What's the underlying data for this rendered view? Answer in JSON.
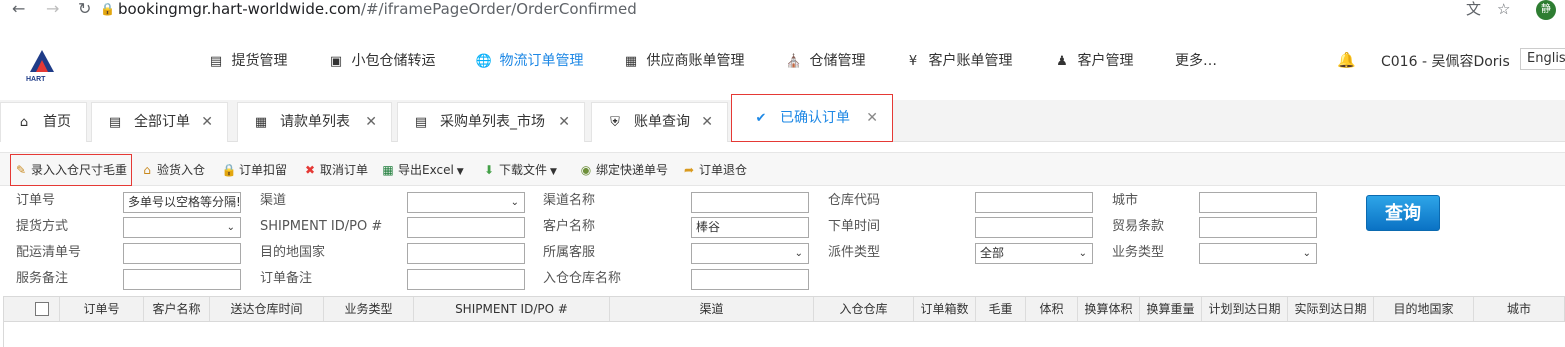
{
  "browser": {
    "url_host": "bookingmgr.hart-worldwide.com",
    "url_path": "/#/iframePageOrder/OrderConfirmed",
    "avatar_text": "静"
  },
  "topnav": {
    "logo_text": "HART",
    "items": [
      {
        "label": "提货管理",
        "icon": "truck-icon"
      },
      {
        "label": "小包仓储转运",
        "icon": "box-icon"
      },
      {
        "label": "物流订单管理",
        "icon": "globe-icon",
        "active": true
      },
      {
        "label": "供应商账单管理",
        "icon": "calendar-icon"
      },
      {
        "label": "仓储管理",
        "icon": "warehouse-icon"
      },
      {
        "label": "客户账单管理",
        "icon": "yen-icon"
      },
      {
        "label": "客户管理",
        "icon": "people-icon"
      },
      {
        "label": "更多…",
        "icon": ""
      }
    ],
    "user": "C016 - 吴佩容Doris",
    "lang": "English"
  },
  "tabs": [
    {
      "label": "首页",
      "icon": "home-icon",
      "closable": false
    },
    {
      "label": "全部订单",
      "icon": "list-icon",
      "closable": true
    },
    {
      "label": "请款单列表",
      "icon": "calendar-icon",
      "closable": true
    },
    {
      "label": "采购单列表_市场",
      "icon": "list-icon",
      "closable": true
    },
    {
      "label": "账单查询",
      "icon": "shield-icon",
      "closable": true
    },
    {
      "label": "已确认订单",
      "icon": "check-circle-icon",
      "closable": true,
      "active": true
    }
  ],
  "toolbar": [
    {
      "label": "录入入仓尺寸毛重",
      "icon": "edit-icon"
    },
    {
      "label": "验货入仓",
      "icon": "house-icon"
    },
    {
      "label": "订单扣留",
      "icon": "lock-icon"
    },
    {
      "label": "取消订单",
      "icon": "x-icon"
    },
    {
      "label": "导出Excel",
      "icon": "excel-icon",
      "dropdown": true
    },
    {
      "label": "下载文件",
      "icon": "download-icon",
      "dropdown": true
    },
    {
      "label": "绑定快递单号",
      "icon": "bind-icon"
    },
    {
      "label": "订单退仓",
      "icon": "return-icon"
    }
  ],
  "filters": {
    "order_no": {
      "label": "订单号",
      "placeholder": "多单号以空格等分隔!"
    },
    "pickup_method": {
      "label": "提货方式",
      "value": ""
    },
    "stowage_no": {
      "label": "配运清单号",
      "value": ""
    },
    "service_note": {
      "label": "服务备注",
      "value": ""
    },
    "channel": {
      "label": "渠道",
      "value": ""
    },
    "shipment_id": {
      "label": "SHIPMENT ID/PO #",
      "value": ""
    },
    "dest_country": {
      "label": "目的地国家",
      "value": ""
    },
    "order_note": {
      "label": "订单备注",
      "value": ""
    },
    "channel_name": {
      "label": "渠道名称",
      "value": ""
    },
    "customer_name": {
      "label": "客户名称",
      "value": "棒谷"
    },
    "customer_service": {
      "label": "所属客服",
      "value": ""
    },
    "warehouse_name": {
      "label": "入仓仓库名称",
      "value": ""
    },
    "warehouse_code": {
      "label": "仓库代码",
      "value": ""
    },
    "order_time": {
      "label": "下单时间",
      "value": ""
    },
    "delivery_type": {
      "label": "派件类型",
      "value": "全部"
    },
    "city": {
      "label": "城市",
      "value": ""
    },
    "trade_terms": {
      "label": "贸易条款",
      "value": ""
    },
    "business_type": {
      "label": "业务类型",
      "value": ""
    },
    "query_label": "查询"
  },
  "grid": {
    "columns": [
      "订单号",
      "客户名称",
      "送达仓库时间",
      "业务类型",
      "SHIPMENT ID/PO #",
      "渠道",
      "入仓仓库",
      "订单箱数",
      "毛重",
      "体积",
      "换算体积",
      "换算重量",
      "计划到达日期",
      "实际到达日期",
      "目的地国家",
      "城市"
    ]
  }
}
